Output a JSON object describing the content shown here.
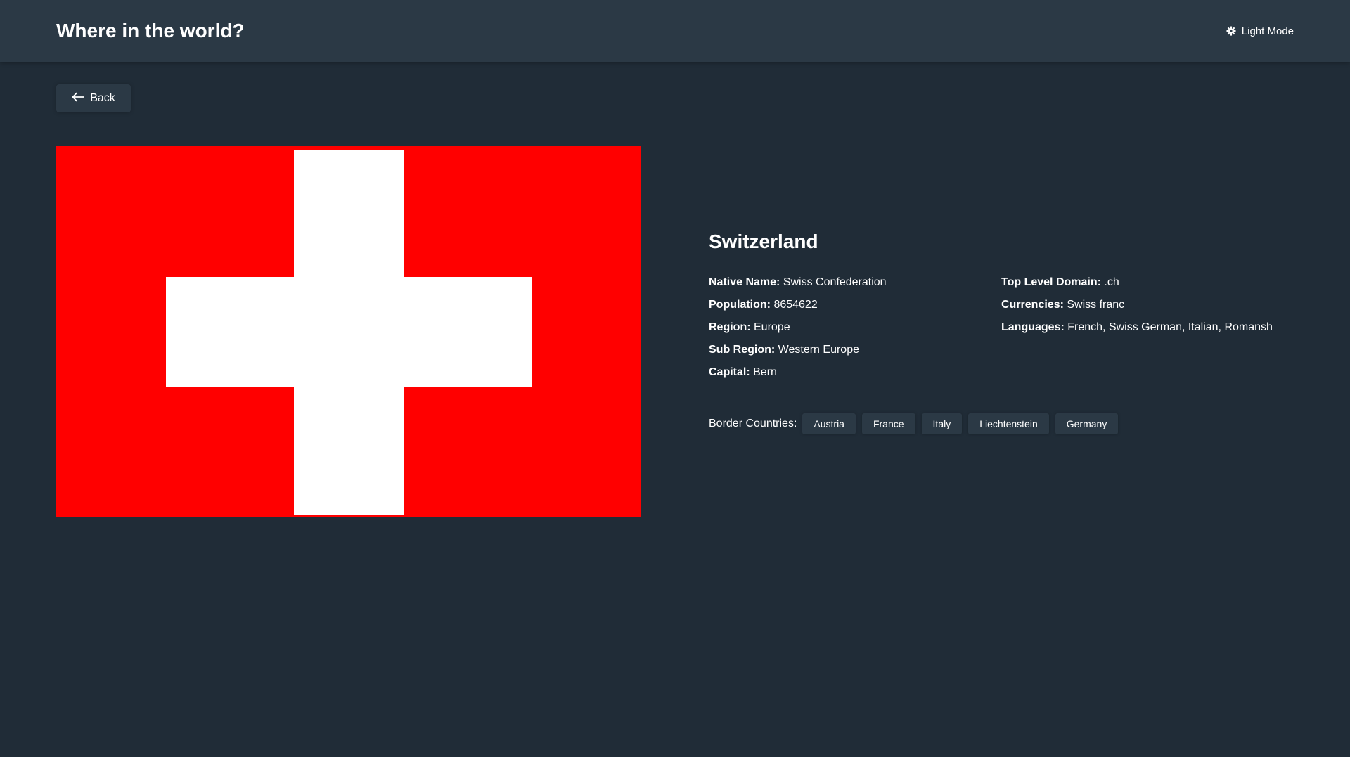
{
  "header": {
    "title": "Where in the world?",
    "theme_toggle_label": "Light Mode",
    "theme_icon": "gear-icon"
  },
  "back": {
    "label": "Back",
    "icon": "arrow-left-icon"
  },
  "flag": {
    "background": "#ff0000",
    "cross": "#ffffff"
  },
  "country": {
    "name": "Switzerland",
    "left": [
      {
        "label": "Native Name:",
        "value": "Swiss Confederation"
      },
      {
        "label": "Population:",
        "value": "8654622"
      },
      {
        "label": "Region:",
        "value": "Europe"
      },
      {
        "label": "Sub Region:",
        "value": "Western Europe"
      },
      {
        "label": "Capital:",
        "value": "Bern"
      }
    ],
    "right": [
      {
        "label": "Top Level Domain:",
        "value": ".ch"
      },
      {
        "label": "Currencies:",
        "value": "Swiss franc"
      },
      {
        "label": "Languages:",
        "value": "French, Swiss German, Italian, Romansh"
      }
    ]
  },
  "borders": {
    "label": "Border Countries:",
    "countries": [
      "Austria",
      "France",
      "Italy",
      "Liechtenstein",
      "Germany"
    ]
  },
  "colors": {
    "background": "#202c37",
    "elements": "#2b3945",
    "text": "#ffffff"
  }
}
